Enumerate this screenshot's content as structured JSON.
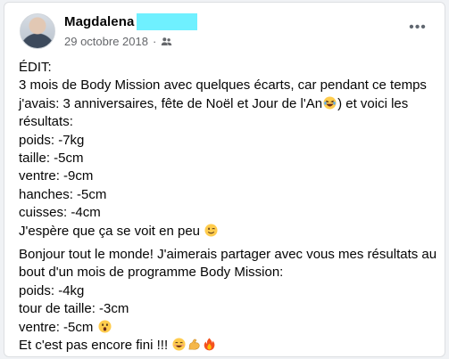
{
  "post": {
    "author": "Magdalena",
    "date": "29 octobre 2018",
    "separator": "·",
    "audience_icon": "friends-icon",
    "more_icon": "more-horizontal-icon"
  },
  "body": {
    "para1": [
      "ÉDIT:",
      "3 mois de Body Mission avec quelques écarts, car pendant ce temps",
      "j'avais: 3 anniversaires, fête de Noël et Jour de l'An",
      ") et voici les",
      "résultats:",
      "poids: -7kg",
      "taille: -5cm",
      "ventre: -9cm",
      "hanches: -5cm",
      "cuisses: -4cm",
      "J'espère que ça se voit en peu"
    ],
    "para2": [
      "Bonjour tout le monde! J'aimerais partager avec vous mes résultats au",
      "bout d'un mois de programme Body Mission:",
      "poids: -4kg",
      "tour de taille: -3cm",
      "ventre: -5cm",
      "Et c'est pas encore fini !!!"
    ]
  },
  "emojis": {
    "laughing": "laughing-face-icon",
    "wink": "winking-face-icon",
    "surprised": "surprised-face-icon",
    "smile": "smiling-face-icon",
    "muscle": "flexed-biceps-icon",
    "fire": "fire-icon"
  },
  "colors": {
    "redaction": "#6ff0ff",
    "text": "#050505",
    "meta": "#65676b"
  }
}
